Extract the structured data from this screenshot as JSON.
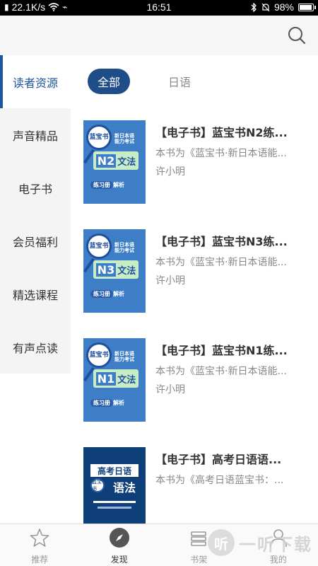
{
  "status_bar": {
    "network_speed": "22.1K/s",
    "time": "16:51",
    "battery": "98%",
    "battery_level": 0.98,
    "icons": [
      "wifi-icon",
      "bluetooth-icon",
      "mute-bell-icon",
      "battery-icon"
    ]
  },
  "header": {
    "search_icon": "search-icon"
  },
  "sidebar": {
    "items": [
      {
        "label": "读者资源",
        "active": true
      },
      {
        "label": "声音精品",
        "active": false
      },
      {
        "label": "电子书",
        "active": false
      },
      {
        "label": "会员福利",
        "active": false
      },
      {
        "label": "精选课程",
        "active": false
      },
      {
        "label": "有声点读",
        "active": false
      }
    ]
  },
  "filters": [
    {
      "label": "全部",
      "active": true
    },
    {
      "label": "日语",
      "active": false
    }
  ],
  "books": [
    {
      "title": "【电子书】蓝宝书N2练...",
      "description": "本书为《蓝宝书·新日本语能...",
      "author": "许小明",
      "cover": {
        "badge": "蓝宝书",
        "subtitle_1": "新日本语",
        "subtitle_2": "能力考试",
        "level": "N2",
        "topic": "文法",
        "practice": "练习册",
        "practice_2": "解析"
      }
    },
    {
      "title": "【电子书】蓝宝书N3练...",
      "description": "本书为《蓝宝书·新日本语能...",
      "author": "许小明",
      "cover": {
        "badge": "蓝宝书",
        "subtitle_1": "新日本语",
        "subtitle_2": "能力考试",
        "level": "N3",
        "topic": "文法",
        "practice": "练习册",
        "practice_2": "解析"
      }
    },
    {
      "title": "【电子书】蓝宝书N1练...",
      "description": "本书为《蓝宝书·新日本语能...",
      "author": "许小明",
      "cover": {
        "badge": "蓝宝书",
        "subtitle_1": "新日本语",
        "subtitle_2": "能力考试",
        "level": "N1",
        "topic": "文法",
        "practice": "练习册",
        "practice_2": "解析"
      }
    },
    {
      "title": "【电子书】高考日语语...",
      "description": "本书为《高考日语蓝宝书：...",
      "author": "",
      "cover": {
        "title": "高考日语",
        "badge": "蓝宝书",
        "topic": "语法"
      }
    }
  ],
  "tabbar": {
    "tabs": [
      {
        "label": "推荐",
        "icon": "star-icon",
        "active": false
      },
      {
        "label": "发现",
        "icon": "compass-icon",
        "active": true
      },
      {
        "label": "书架",
        "icon": "bookshelf-icon",
        "active": false
      },
      {
        "label": "我的",
        "icon": "profile-icon",
        "active": false
      }
    ]
  },
  "watermark": {
    "glyph": "听",
    "text": "一听下载"
  },
  "colors": {
    "accent": "#1e56a0",
    "chip_active": "#1e4d88",
    "cover_blue": "#3d7ec6",
    "cover_dark": "#0f3f78"
  }
}
